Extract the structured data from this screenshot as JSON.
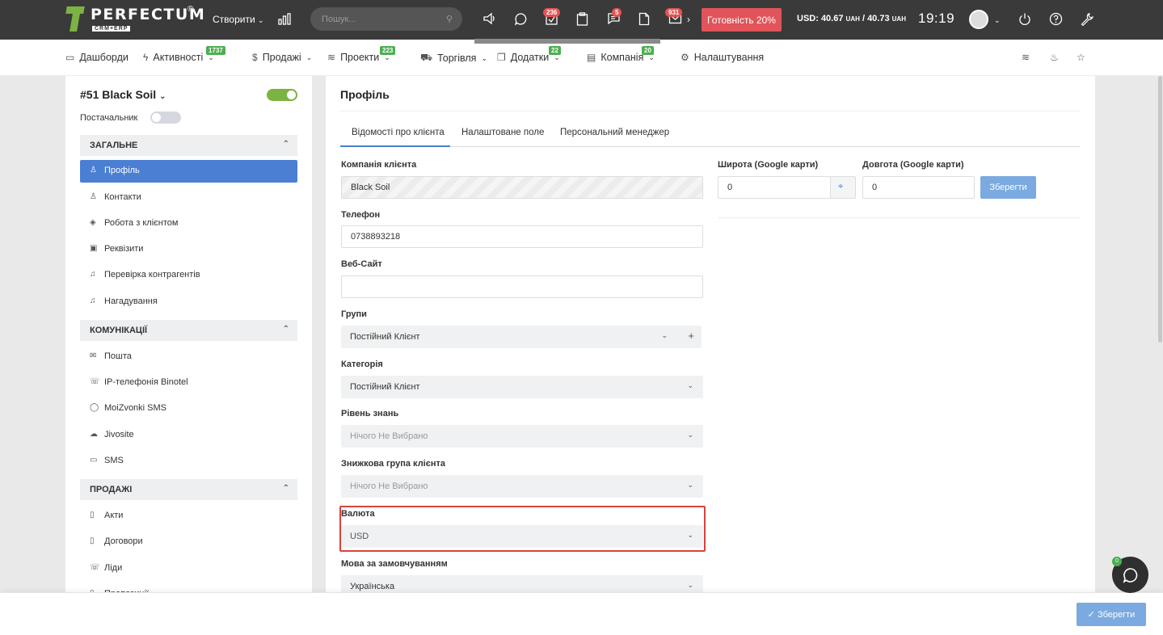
{
  "topbar": {
    "logo_text": "PERFECTUM",
    "logo_sub": "CRM+ERP",
    "logo_reg": "®",
    "create_label": "Створити",
    "search_placeholder": "Пошук...",
    "badges": {
      "tasks": "236",
      "messages": "5",
      "mail": "931"
    },
    "readiness_label": "Готовність 20%",
    "currency_prefix": "USD: 40.67",
    "currency_unit1": "UAH",
    "currency_mid": "/ 40.73",
    "currency_unit2": "UAH",
    "time": "19:19",
    "colors": {
      "bar": "#3a3a3a",
      "ready": "#e0545a",
      "badge": "#e55353"
    }
  },
  "nav": {
    "items": [
      {
        "label": "Дашборди",
        "icon": "monitor-icon"
      },
      {
        "label": "Активності",
        "icon": "bolt-icon",
        "badge": "1737"
      },
      {
        "label": "Продажі",
        "icon": "dollar-icon"
      },
      {
        "label": "Проекти",
        "icon": "layers-icon",
        "badge": "223"
      },
      {
        "label": "Торгівля",
        "icon": "cart-icon"
      },
      {
        "label": "Додатки",
        "icon": "copy-icon",
        "badge": "22"
      },
      {
        "label": "Компанія",
        "icon": "building-icon",
        "badge": "20"
      },
      {
        "label": "Налаштування",
        "icon": "gear-icon"
      }
    ]
  },
  "sidebar": {
    "client_title": "#51 Black Soil",
    "supplier_label": "Постачальник",
    "sections": [
      {
        "title": "Загальне",
        "items": [
          "Профіль",
          "Контакти",
          "Робота з клієнтом",
          "Реквізити",
          "Перевірка контрагентів",
          "Нагадування"
        ]
      },
      {
        "title": "Комунікації",
        "items": [
          "Пошта",
          "IP-телефонія Binotel",
          "MoiZvonki SMS",
          "Jivosite",
          "SMS"
        ]
      },
      {
        "title": "Продажі",
        "items": [
          "Акти",
          "Договори",
          "Ліди",
          "Пропозиції"
        ]
      }
    ]
  },
  "main": {
    "page_title": "Профіль",
    "tabs": [
      "Відомості про клієнта",
      "Налаштоване поле",
      "Персональний менеджер"
    ],
    "fields": {
      "company_label": "Компанія клієнта",
      "company_value": "Black Soil",
      "phone_label": "Телефон",
      "phone_value": "0738893218",
      "website_label": "Веб-Сайт",
      "website_value": "",
      "groups_label": "Групи",
      "groups_value": "Постійний Клієнт",
      "category_label": "Категорія",
      "category_value": "Постійний Клієнт",
      "knowledge_label": "Рівень знань",
      "knowledge_value": "Нічого Не Вибрано",
      "discount_label": "Знижкова група клієнта",
      "discount_value": "Нічого Не Вибрано",
      "currency_label": "Валюта",
      "currency_value": "USD",
      "language_label": "Мова за замовчуванням",
      "language_value": "Українська",
      "lat_label": "Широта (Google карти)",
      "lat_value": "0",
      "lng_label": "Довгота (Google карти)",
      "lng_value": "0",
      "save_coords_label": "Зберегти"
    }
  },
  "footer": {
    "save_label": "✓ Зберегти",
    "chat_badge": "0"
  }
}
